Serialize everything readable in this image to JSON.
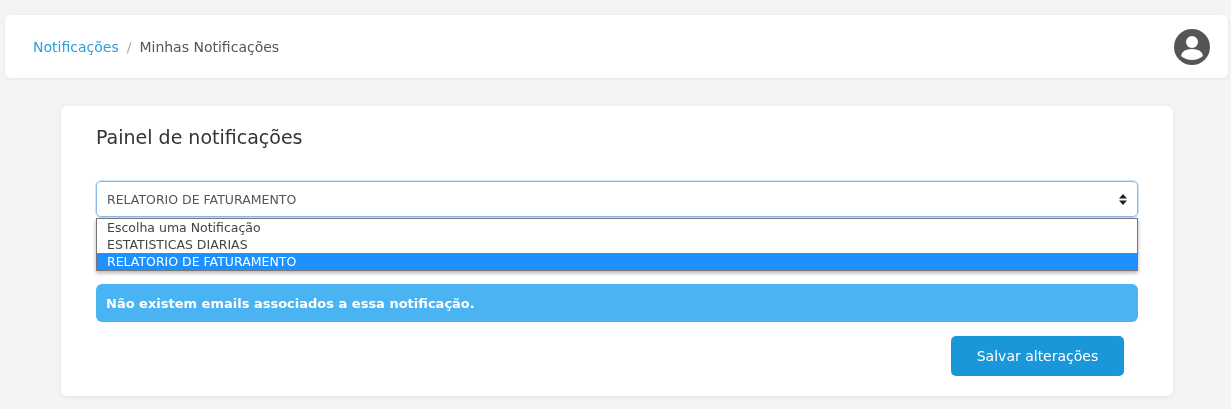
{
  "breadcrumb_separator": "/",
  "breadcrumb": [
    {
      "label": "Notificações",
      "kind": "link"
    },
    {
      "label": "Minhas Notificações",
      "kind": "current"
    }
  ],
  "panel": {
    "title": "Painel de notificações",
    "select": {
      "value": "RELATORIO DE FATURAMENTO",
      "expanded": true,
      "options": [
        {
          "label": "Escolha uma Notificação",
          "selected": false
        },
        {
          "label": "ESTATISTICAS DIARIAS",
          "selected": false
        },
        {
          "label": "RELATORIO DE FATURAMENTO",
          "selected": true
        }
      ]
    },
    "alert": "Não existem emails associados a essa notificação.",
    "save_button": "Salvar alterações"
  }
}
